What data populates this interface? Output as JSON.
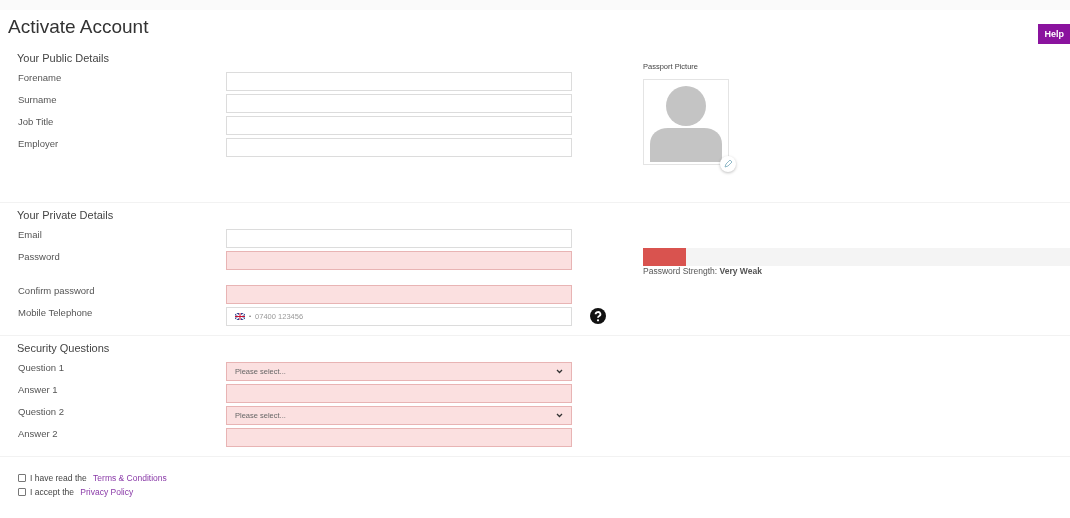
{
  "title": "Activate Account",
  "help_button": "Help",
  "public": {
    "heading": "Your Public Details",
    "fields": [
      {
        "label": "Forename",
        "invalid": false
      },
      {
        "label": "Surname",
        "invalid": false
      },
      {
        "label": "Job Title",
        "invalid": false
      },
      {
        "label": "Employer",
        "invalid": false
      }
    ],
    "passport": {
      "label": "Passport Picture"
    }
  },
  "private": {
    "heading": "Your Private Details",
    "fields": [
      {
        "label": "Email",
        "invalid": false
      },
      {
        "label": "Password",
        "kind": "password",
        "invalid": true
      },
      {
        "label": "Confirm password",
        "invalid": true
      },
      {
        "label": "Mobile Telephone",
        "kind": "phone",
        "invalid": false,
        "placeholder": "07400 123456",
        "flag_separator": "•"
      }
    ],
    "strength": {
      "level": 0.1,
      "label": "Password Strength: **Very Weak**"
    }
  },
  "security": {
    "heading": "Security Questions",
    "fields": [
      {
        "label": "Question 1",
        "kind": "select",
        "invalid": true,
        "value": "Please select..."
      },
      {
        "label": "Answer 1",
        "invalid": true
      },
      {
        "label": "Question 2",
        "kind": "select",
        "invalid": true,
        "value": "Please select..."
      },
      {
        "label": "Answer 2",
        "invalid": true
      }
    ]
  },
  "agreements": [
    {
      "text": "I have read the ",
      "link": "Terms & Conditions",
      "checked": false
    },
    {
      "text": "I accept the ",
      "link": "Privacy Policy",
      "checked": false
    }
  ]
}
